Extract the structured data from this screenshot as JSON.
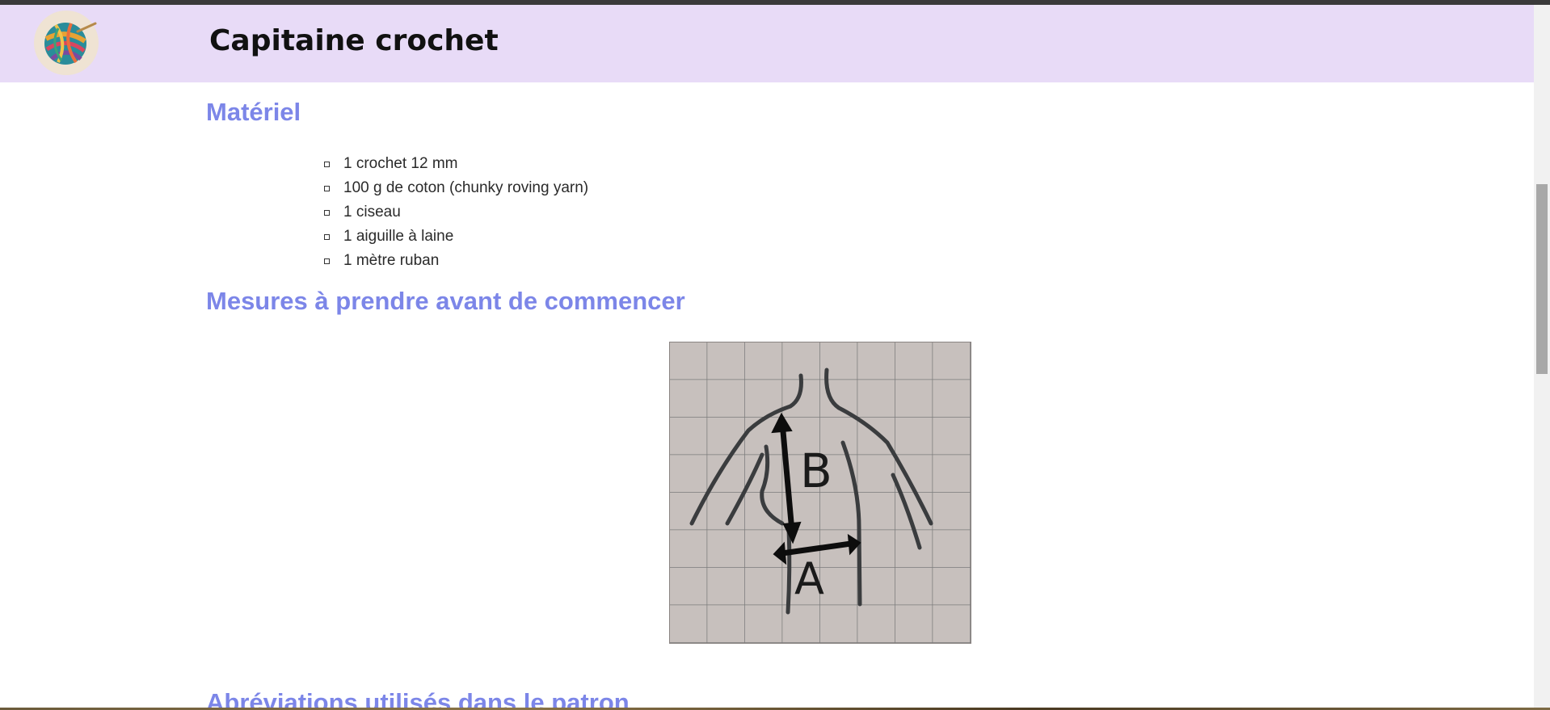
{
  "header": {
    "title": "Capitaine crochet"
  },
  "sections": {
    "materiel": {
      "heading": "Matériel",
      "items": [
        "1 crochet 12 mm",
        "100 g de coton (chunky roving yarn)",
        "1 ciseau",
        "1 aiguille à laine",
        "1 mètre ruban"
      ]
    },
    "mesures": {
      "heading": "Mesures à prendre avant de commencer",
      "figure_labels": {
        "a": "A",
        "b": "B"
      }
    },
    "abreviations": {
      "heading": "Abréviations utilisés dans le patron"
    }
  },
  "colors": {
    "header_bg": "#e8dbf7",
    "heading": "#7c86e8"
  }
}
